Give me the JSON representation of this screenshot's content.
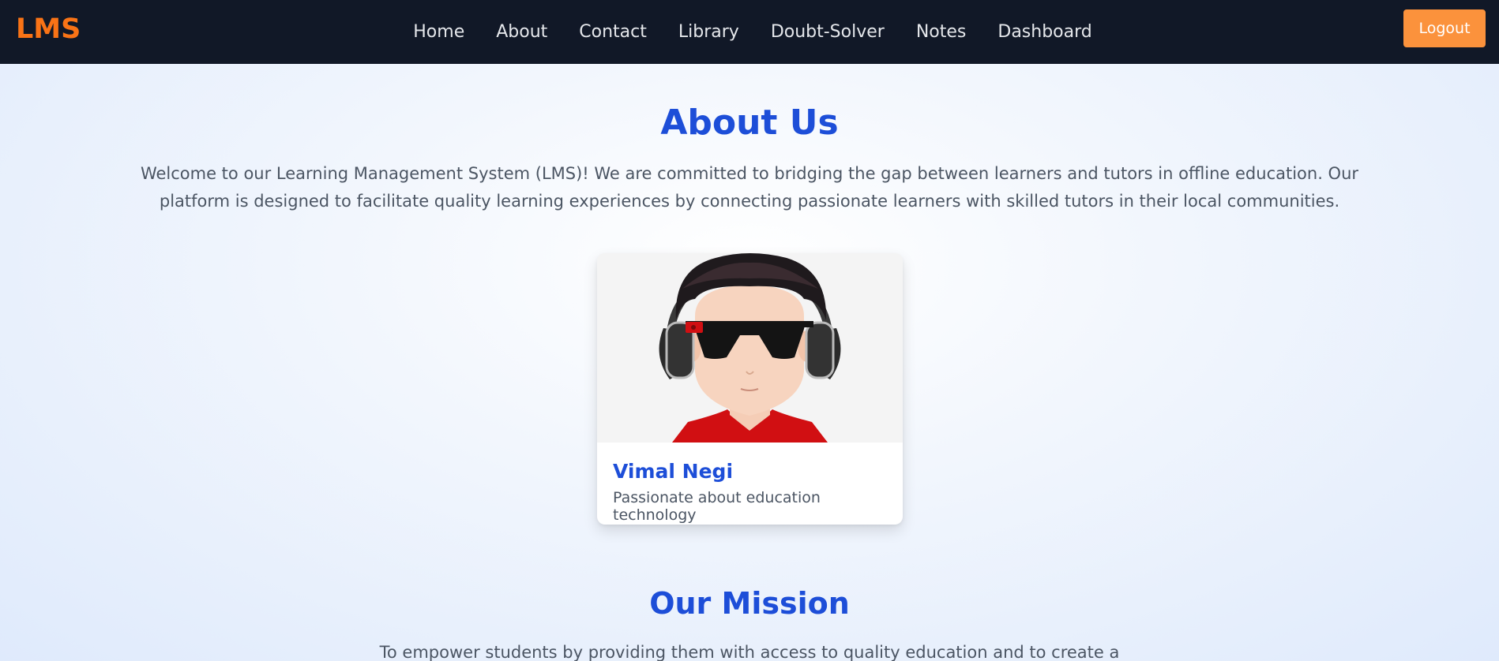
{
  "brand": {
    "logo": "LMS",
    "color": "#f97316"
  },
  "nav": {
    "links": [
      "Home",
      "About",
      "Contact",
      "Library",
      "Doubt-Solver",
      "Notes",
      "Dashboard"
    ],
    "logout_label": "Logout"
  },
  "about": {
    "title": "About Us",
    "text": "Welcome to our Learning Management System (LMS)! We are committed to bridging the gap between learners and tutors in offline education. Our platform is designed to facilitate quality learning experiences by connecting passionate learners with skilled tutors in their local communities."
  },
  "team": [
    {
      "name": "Vimal Negi",
      "description": "Passionate about education technology",
      "avatar_icon": "avatar-cartoon-sunglasses-headphones"
    }
  ],
  "mission": {
    "title": "Our Mission",
    "text": "To empower students by providing them with access to quality education and to create a"
  },
  "colors": {
    "accent": "#1d4ed8",
    "navbar": "#111827",
    "logout": "#fb923c"
  }
}
